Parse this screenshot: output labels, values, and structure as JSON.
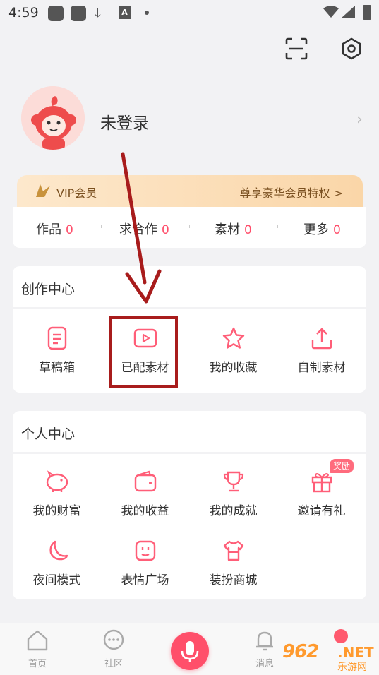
{
  "status_bar": {
    "time": "4:59"
  },
  "profile": {
    "login_status": "未登录",
    "chevron": "›"
  },
  "vip": {
    "label": "VIP会员",
    "benefits": "尊享豪华会员特权 >"
  },
  "stats": [
    {
      "label": "作品",
      "count": "0"
    },
    {
      "label": "求合作",
      "count": "0"
    },
    {
      "label": "素材",
      "count": "0"
    },
    {
      "label": "更多",
      "count": "0"
    }
  ],
  "creation_center": {
    "title": "创作中心",
    "items": [
      {
        "label": "草稿箱",
        "icon": "draft-icon"
      },
      {
        "label": "已配素材",
        "icon": "video-play-icon"
      },
      {
        "label": "我的收藏",
        "icon": "star-icon"
      },
      {
        "label": "自制素材",
        "icon": "upload-icon"
      }
    ]
  },
  "personal_center": {
    "title": "个人中心",
    "reward_badge": "奖励",
    "items": [
      {
        "label": "我的财富",
        "icon": "piggy-bank-icon"
      },
      {
        "label": "我的收益",
        "icon": "wallet-icon"
      },
      {
        "label": "我的成就",
        "icon": "trophy-icon"
      },
      {
        "label": "邀请有礼",
        "icon": "gift-icon"
      },
      {
        "label": "夜间模式",
        "icon": "moon-icon"
      },
      {
        "label": "表情广场",
        "icon": "emoji-icon"
      },
      {
        "label": "装扮商城",
        "icon": "shirt-icon"
      }
    ]
  },
  "bottom_nav": {
    "home": "首页",
    "community": "社区",
    "messages": "消息"
  },
  "watermark": {
    "number": "962",
    "net": ".NET",
    "site": "乐游网"
  },
  "colors": {
    "accent": "#ff4d6a",
    "annotation": "#a81c1c",
    "vip_text": "#7a5020"
  }
}
